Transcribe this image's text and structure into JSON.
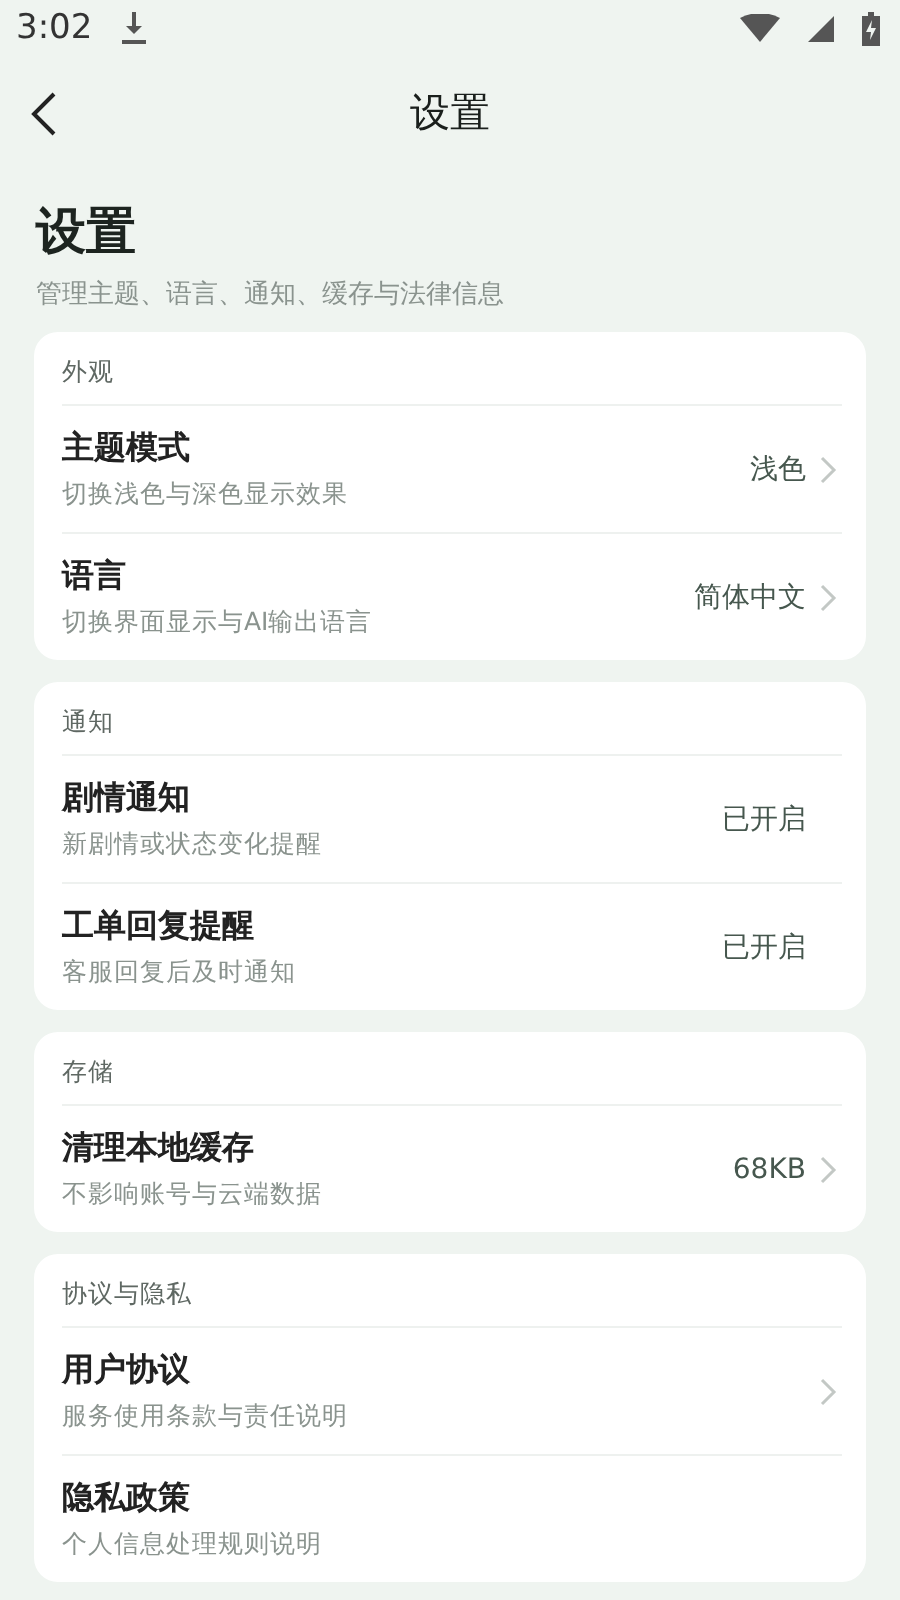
{
  "status_bar": {
    "time": "3:02"
  },
  "app_bar": {
    "title": "设置"
  },
  "header": {
    "title": "设置",
    "subtitle": "管理主题、语言、通知、缓存与法律信息"
  },
  "sections": [
    {
      "label": "外观",
      "rows": [
        {
          "title": "主题模式",
          "subtitle": "切换浅色与深色显示效果",
          "value": "浅色",
          "chevron": true
        },
        {
          "title": "语言",
          "subtitle": "切换界面显示与AI输出语言",
          "value": "简体中文",
          "chevron": true
        }
      ]
    },
    {
      "label": "通知",
      "rows": [
        {
          "title": "剧情通知",
          "subtitle": "新剧情或状态变化提醒",
          "value": "已开启",
          "chevron": false
        },
        {
          "title": "工单回复提醒",
          "subtitle": "客服回复后及时通知",
          "value": "已开启",
          "chevron": false
        }
      ]
    },
    {
      "label": "存储",
      "rows": [
        {
          "title": "清理本地缓存",
          "subtitle": "不影响账号与云端数据",
          "value": "68KB",
          "chevron": true
        }
      ]
    },
    {
      "label": "协议与隐私",
      "rows": [
        {
          "title": "用户协议",
          "subtitle": "服务使用条款与责任说明",
          "chevron": true
        },
        {
          "title": "隐私政策",
          "subtitle": "个人信息处理规则说明",
          "chevron": false
        }
      ]
    }
  ]
}
